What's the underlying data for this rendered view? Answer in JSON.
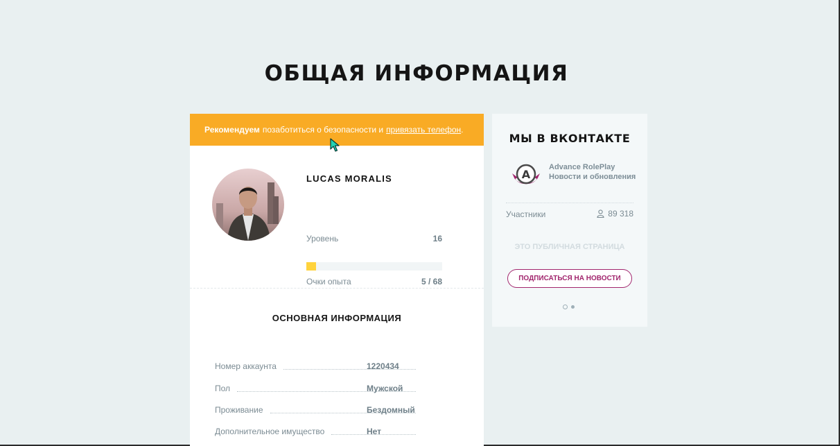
{
  "page": {
    "title": "ОБЩАЯ ИНФОРМАЦИЯ"
  },
  "alert": {
    "strong": "Рекомендуем",
    "text": "позаботиться о безопасности и",
    "link": "привязать телефон",
    "end": "."
  },
  "profile": {
    "username": "LUCAS MORALIS",
    "level_label": "Уровень",
    "level_value": "16",
    "xp_label": "Очки опыта",
    "xp_value": "5 / 68",
    "xp_fraction": 0.0735
  },
  "basic_info": {
    "title": "ОСНОВНАЯ ИНФОРМАЦИЯ",
    "rows": [
      {
        "label": "Номер аккаунта",
        "value": "1220434"
      },
      {
        "label": "Пол",
        "value": "Мужской"
      },
      {
        "label": "Проживание",
        "value": "Бездомный"
      },
      {
        "label": "Дополнительное имущество",
        "value": "Нет"
      }
    ]
  },
  "vk": {
    "title": "МЫ В ВКОНТАКТЕ",
    "group_name": "Advance RolePlay",
    "group_desc": "Новости и обновления",
    "members_label": "Участники",
    "members_count": "89 318",
    "public_note": "ЭТО ПУБЛИЧНАЯ СТРАНИЦА",
    "subscribe_label": "ПОДПИСАТЬСЯ НА НОВОСТИ",
    "logo_letter": "A"
  },
  "colors": {
    "alert": "#f9ab25",
    "xp_fill": "#ffd33d",
    "vk_accent": "#a1256d",
    "background": "#e9f0f1"
  }
}
